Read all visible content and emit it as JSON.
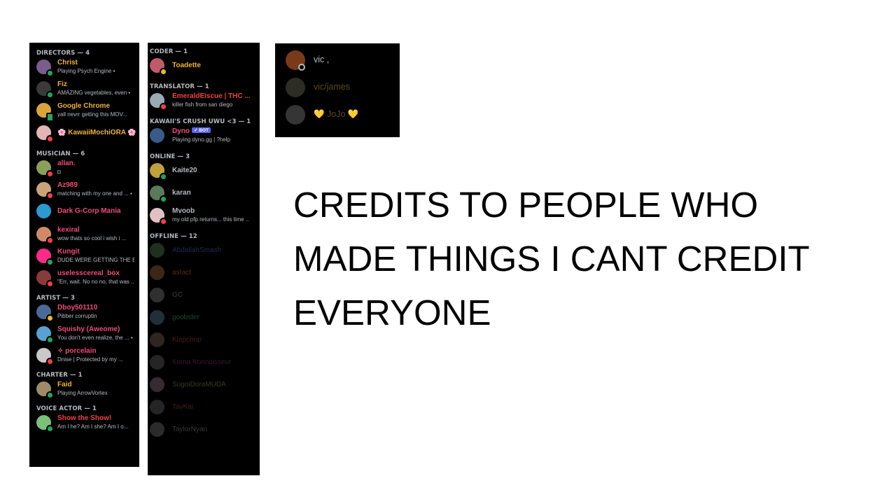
{
  "panel_left": {
    "groups": [
      {
        "header": "DIRECTORS — 4",
        "members": [
          {
            "name": "Christ",
            "status_text": "Playing Psych Engine ▪",
            "name_color": "#f0b232",
            "avatar_color": "#7a5c8e",
            "presence": "online"
          },
          {
            "name": "Fiz",
            "status_text": "AMAZING vegetables, even ▪",
            "name_color": "#f0b232",
            "avatar_color": "#3a3a3a",
            "presence": "online"
          },
          {
            "name": "Google Chrome",
            "status_text": "yall nevrr getting this MOV...",
            "name_color": "#f0b232",
            "avatar_color": "#d9a53a",
            "presence": "mobile"
          },
          {
            "name": "🌸 KawaiiMochiORA 🌸",
            "status_text": "",
            "name_color": "#f0b232",
            "avatar_color": "#e3b5b5",
            "presence": "dnd"
          }
        ]
      },
      {
        "header": "MUSICIAN — 6",
        "members": [
          {
            "name": "allan.",
            "status_text": "◘",
            "name_color": "#f04a7a",
            "avatar_color": "#8aa05a",
            "presence": "dnd"
          },
          {
            "name": "Az989",
            "status_text": "matching with my one and ... ▪",
            "name_color": "#f04a7a",
            "avatar_color": "#c9a37a",
            "presence": "dnd"
          },
          {
            "name": "Dark G-Corp Mania",
            "status_text": "",
            "name_color": "#f04a7a",
            "avatar_color": "#2a9ad0",
            "presence": "none"
          },
          {
            "name": "kexiral",
            "status_text": "wow thats so cool i wish i ...",
            "name_color": "#f04a7a",
            "avatar_color": "#d08a6a",
            "presence": "dnd"
          },
          {
            "name": "Kungit",
            "status_text": "DUDE WERE GETTING THE B...",
            "name_color": "#f04a7a",
            "avatar_color": "#ff2a8a",
            "presence": "online"
          },
          {
            "name": "uselesscereal_box",
            "status_text": "\"Err, wait. No no no, that was ...",
            "name_color": "#f04a7a",
            "avatar_color": "#8a3a3a",
            "presence": "dnd"
          }
        ]
      },
      {
        "header": "ARTIST — 3",
        "members": [
          {
            "name": "Dboy501110",
            "status_text": "Pibber corruptin",
            "name_color": "#f04a7a",
            "avatar_color": "#4a6a9a",
            "presence": "idle"
          },
          {
            "name": "Squishy (Aweome)",
            "status_text": "You don't even realize, the ... ▪",
            "name_color": "#f04a7a",
            "avatar_color": "#5aa0d0",
            "presence": "online"
          },
          {
            "name": "✧ porcelain",
            "status_text": "Dnise | Protected by my ...",
            "name_color": "#f04a7a",
            "avatar_color": "#c9c9c9",
            "presence": "dnd"
          }
        ]
      },
      {
        "header": "CHARTER — 1",
        "members": [
          {
            "name": "Faid",
            "status_text": "Playing ArrowVortex",
            "name_color": "#f0b232",
            "avatar_color": "#a08a6a",
            "presence": "online"
          }
        ]
      },
      {
        "header": "VOICE ACTOR — 1",
        "members": [
          {
            "name": "Show the Show!",
            "status_text": "Am I he? Am I she? Am I o...",
            "name_color": "#f23f43",
            "avatar_color": "#7ac07a",
            "presence": "online"
          }
        ]
      }
    ]
  },
  "panel_middle": {
    "groups": [
      {
        "header": "CODER — 1",
        "members": [
          {
            "name": "Toadette",
            "status_text": "",
            "name_color": "#f0b232",
            "avatar_color": "#c05a6a",
            "presence": "idle"
          }
        ]
      },
      {
        "header": "TRANSLATOR — 1",
        "members": [
          {
            "name": "EmeraldEiscue | THC ...",
            "status_text": "killer fish from san diego",
            "name_color": "#f23f43",
            "avatar_color": "#9aaab5",
            "presence": "dnd"
          }
        ]
      },
      {
        "header": "KAWAII'S CRUSH UWU <3 — 1",
        "members": [
          {
            "name": "Dyno",
            "bot_tag": "✓ BOT",
            "status_text": "Playing dyno.gg | ?help",
            "name_color": "#f04a7a",
            "avatar_color": "#3a5a8a",
            "presence": "none"
          }
        ]
      },
      {
        "header": "ONLINE — 3",
        "members": [
          {
            "name": "Kaite20",
            "status_text": "",
            "name_color": "#b5bac1",
            "avatar_color": "#c0a03a",
            "presence": "online"
          },
          {
            "name": "karan",
            "status_text": "",
            "name_color": "#b5bac1",
            "avatar_color": "#5a7a5a",
            "presence": "online"
          },
          {
            "name": "Mvoob",
            "status_text": "my old pfp returns... this time ...",
            "name_color": "#b5bac1",
            "avatar_color": "#e0c0c0",
            "presence": "dnd"
          }
        ]
      },
      {
        "header": "OFFLINE — 12",
        "members": [
          {
            "name": "AbdallahSmash",
            "name_color": "#1e2a55",
            "avatar_color": "#5a8a5a"
          },
          {
            "name": "astact",
            "name_color": "#5a2a1a",
            "avatar_color": "#b0703a"
          },
          {
            "name": "GC",
            "name_color": "#3a3a3a",
            "avatar_color": "#8a8a8a"
          },
          {
            "name": "goobster",
            "name_color": "#1a4a2a",
            "avatar_color": "#5a8aa0"
          },
          {
            "name": "Klapchop",
            "name_color": "#4a1a1a",
            "avatar_color": "#8a6a5a"
          },
          {
            "name": "Koma Konnoisseur",
            "name_color": "#3a1a2a",
            "avatar_color": "#6a6a6a"
          },
          {
            "name": "SugoiDoraMUDA",
            "name_color": "#3a3a1a",
            "avatar_color": "#9a7a8a"
          },
          {
            "name": "TayKai",
            "name_color": "#4a1a1a",
            "avatar_color": "#6a6a6a"
          },
          {
            "name": "TaylorNyan",
            "name_color": "#3a3a3a",
            "avatar_color": "#7a7a7a"
          }
        ]
      }
    ]
  },
  "panel_right": {
    "members": [
      {
        "name": "vic ,",
        "name_color": "#b5bac1",
        "avatar_color": "#7a3a1a",
        "presence": "offline"
      },
      {
        "name": "vic/james",
        "name_color": "#5a4a1a",
        "avatar_color": "#5a5a4a"
      },
      {
        "name": "💛 JoJo 💛",
        "name_color": "#5a4a1a",
        "avatar_color": "#6a6a6a"
      }
    ]
  },
  "headline": {
    "lines": [
      "CREDITS TO PEOPLE WHO",
      "MADE THINGS I CANT CREDIT",
      "EVERYONE"
    ]
  }
}
